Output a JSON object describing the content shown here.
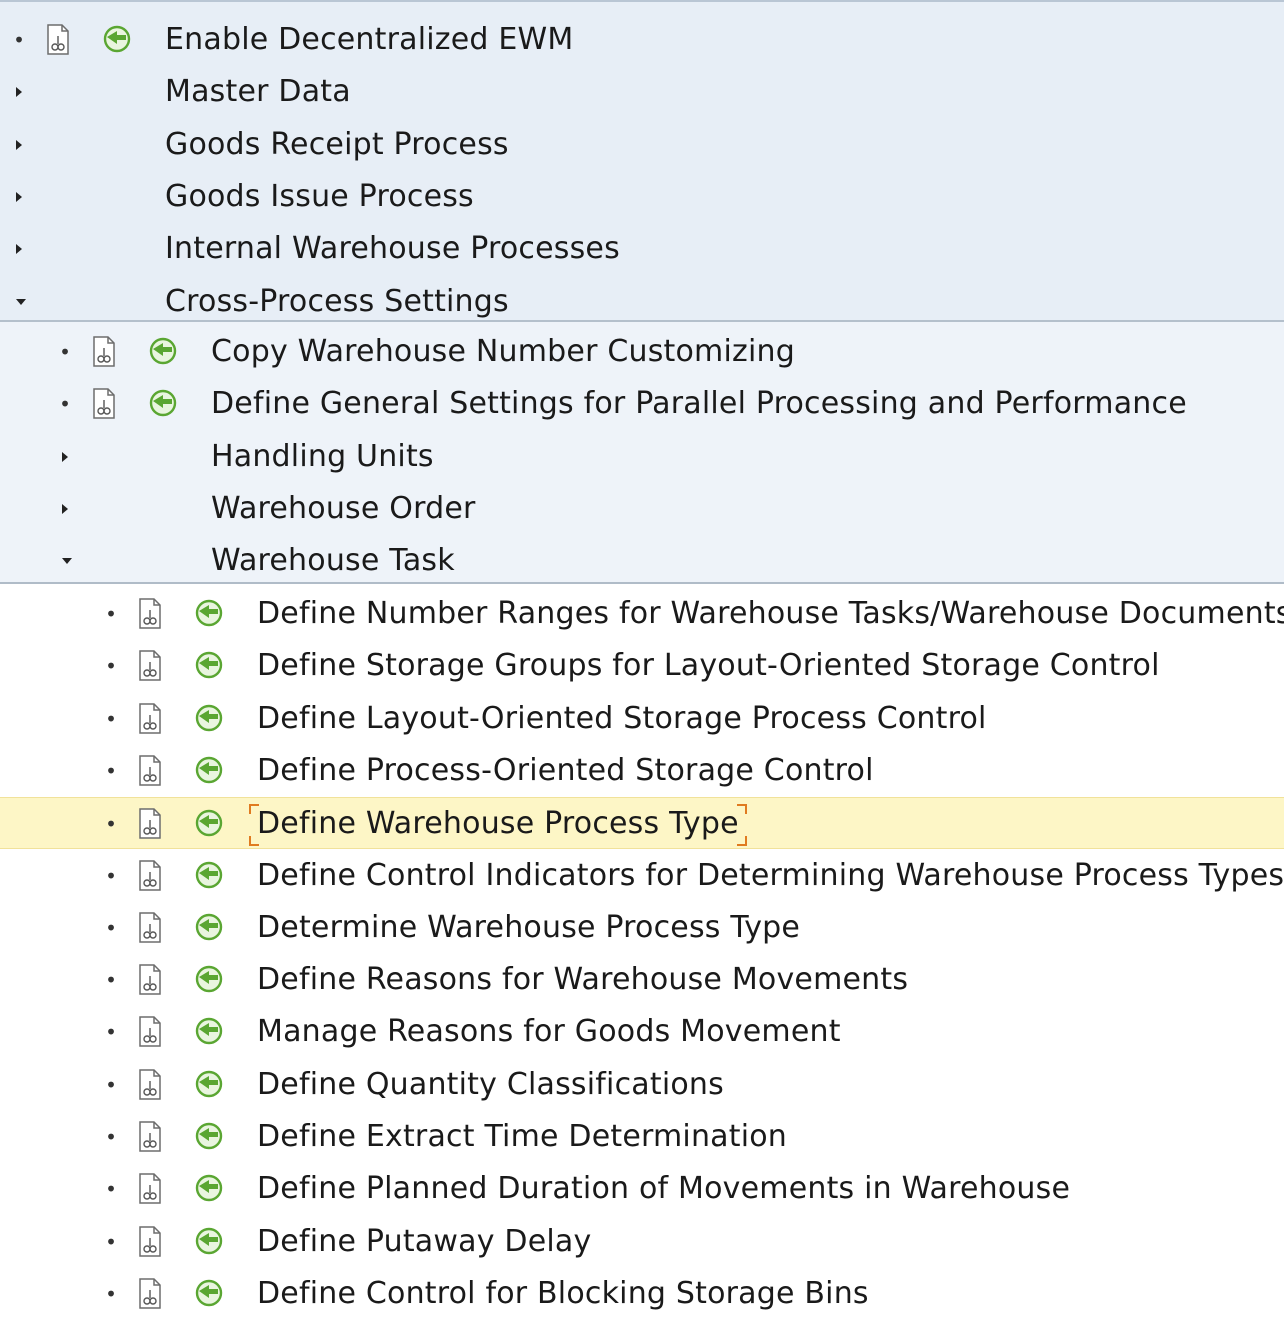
{
  "tree": {
    "top_level": [
      {
        "label": "Enable Decentralized EWM",
        "type": "activity"
      },
      {
        "label": "Master Data",
        "type": "folder",
        "expanded": false
      },
      {
        "label": "Goods Receipt Process",
        "type": "folder",
        "expanded": false
      },
      {
        "label": "Goods Issue Process",
        "type": "folder",
        "expanded": false
      },
      {
        "label": "Internal Warehouse Processes",
        "type": "folder",
        "expanded": false
      },
      {
        "label": "Cross-Process Settings",
        "type": "folder",
        "expanded": true
      }
    ],
    "cross_process": [
      {
        "label": "Copy Warehouse Number Customizing",
        "type": "activity"
      },
      {
        "label": "Define General Settings for Parallel Processing and Performance",
        "type": "activity"
      },
      {
        "label": "Handling Units",
        "type": "folder",
        "expanded": false
      },
      {
        "label": "Warehouse Order",
        "type": "folder",
        "expanded": false
      },
      {
        "label": "Warehouse Task",
        "type": "folder",
        "expanded": true
      }
    ],
    "warehouse_task": [
      {
        "label": "Define Number Ranges for Warehouse Tasks/Warehouse Documents",
        "type": "activity"
      },
      {
        "label": "Define Storage Groups for Layout-Oriented Storage Control",
        "type": "activity"
      },
      {
        "label": "Define Layout-Oriented Storage Process Control",
        "type": "activity"
      },
      {
        "label": "Define Process-Oriented Storage Control",
        "type": "activity"
      },
      {
        "label": "Define Warehouse Process Type",
        "type": "activity",
        "selected": true
      },
      {
        "label": "Define Control Indicators for Determining Warehouse Process Types",
        "type": "activity"
      },
      {
        "label": "Determine Warehouse Process Type",
        "type": "activity"
      },
      {
        "label": "Define Reasons for Warehouse Movements",
        "type": "activity"
      },
      {
        "label": "Manage Reasons for Goods Movement",
        "type": "activity"
      },
      {
        "label": "Define Quantity Classifications",
        "type": "activity"
      },
      {
        "label": "Define Extract Time Determination",
        "type": "activity"
      },
      {
        "label": "Define Planned Duration of Movements in Warehouse",
        "type": "activity"
      },
      {
        "label": "Define Putaway Delay",
        "type": "activity"
      },
      {
        "label": "Define Control for Blocking Storage Bins",
        "type": "activity"
      }
    ]
  },
  "icons": {
    "document": "documentation-icon",
    "execute": "execute-activity-icon"
  },
  "colors": {
    "level0_background": "#e7eef6",
    "level1_background": "#eef3f9",
    "level2_background": "#ffffff",
    "selected_row": "#fdf6c6",
    "focus_corners": "#e07b20",
    "execute_icon": "#5aa632"
  }
}
